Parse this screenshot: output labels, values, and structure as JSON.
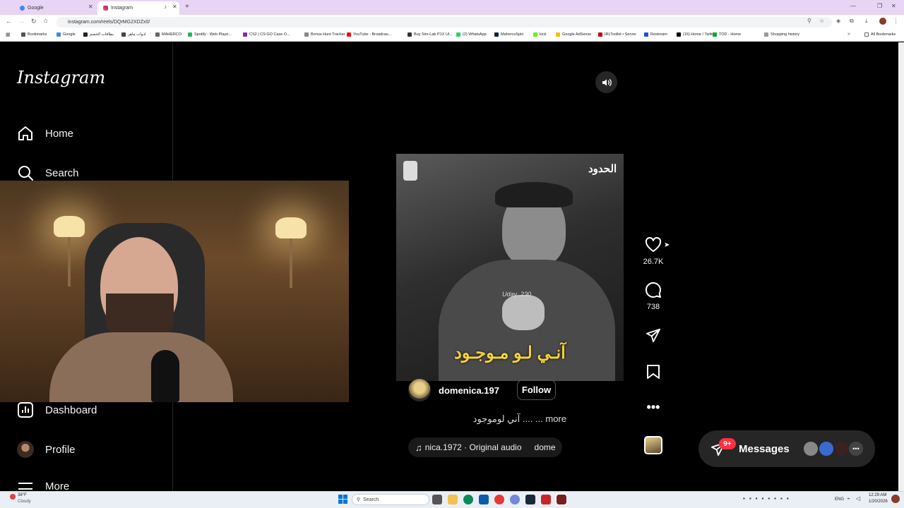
{
  "browser": {
    "tabs": [
      {
        "label": "Google",
        "active": false
      },
      {
        "label": "Instagram",
        "active": true
      }
    ],
    "url": "instagram.com/reels/DQrMG2XDZx0/",
    "bookmarks": [
      {
        "label": "Bookmarks",
        "color": "#555"
      },
      {
        "label": "Google",
        "color": "#4285f4"
      },
      {
        "label": "بطاقات الخصم",
        "color": "#222"
      },
      {
        "label": "ادوات ماهر",
        "color": "#444"
      },
      {
        "label": "MAHERCO",
        "color": "#666"
      },
      {
        "label": "Spotify - Web Playe...",
        "color": "#1db954"
      },
      {
        "label": "CS2 | CS:GO Case O...",
        "color": "#7b2cbf"
      },
      {
        "label": "Bonus Hunt Tracker",
        "color": "#888"
      },
      {
        "label": "YouTube - Broadcas...",
        "color": "#ff0000"
      },
      {
        "label": "Buy Sim-Lab P1X Ul...",
        "color": "#333"
      },
      {
        "label": "(2) WhatsApp",
        "color": "#25d366"
      },
      {
        "label": "MahercoSpin",
        "color": "#123"
      },
      {
        "label": "kick",
        "color": "#53fc18"
      },
      {
        "label": "Google AdSense",
        "color": "#fbbc04"
      },
      {
        "label": "IRLToolkit • Server",
        "color": "#c00"
      },
      {
        "label": "Restream",
        "color": "#2050e0"
      },
      {
        "label": "(16) Home / Twitter",
        "color": "#000"
      },
      {
        "label": "TOD - Home",
        "color": "#0a3"
      },
      {
        "label": "Shopping history",
        "color": "#999"
      }
    ],
    "all_bookmarks": "All Bookmarks"
  },
  "instagram": {
    "logo": "Instagram",
    "nav": {
      "home": "Home",
      "search": "Search",
      "dashboard": "Dashboard",
      "profile": "Profile",
      "more": "More"
    },
    "reel": {
      "username": "domenica.197",
      "follow": "Follow",
      "caption": "آني لوموجود .... ... more",
      "audio": "nica.1972 · Original audio",
      "audio_tag": "dome",
      "subtitle": "آنـي لـو مـوجـود",
      "watermark": "Uday_230",
      "logo_text": "الحدود"
    },
    "actions": {
      "likes": "26.7K",
      "comments": "738"
    },
    "messages": {
      "label": "Messages",
      "badge": "9+"
    }
  },
  "taskbar": {
    "weather_temp": "38°F",
    "weather_desc": "Cloudy",
    "search": "Search",
    "lang": "ENG",
    "time": "12:29 AM",
    "date": "1/20/2026"
  },
  "colors": {
    "follow_border": "#555555",
    "badge": "#ff3040",
    "tab_strip": "#e8d5f5"
  }
}
